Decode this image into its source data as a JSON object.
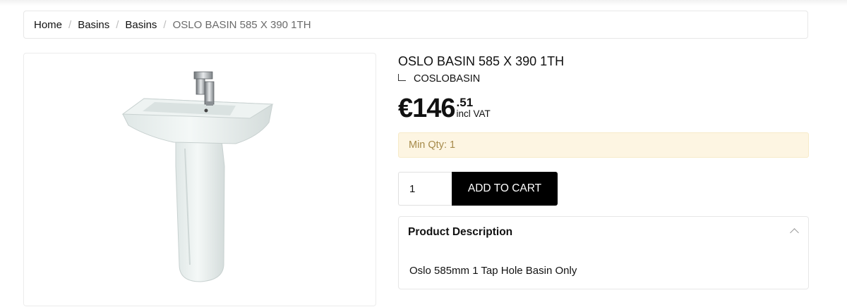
{
  "breadcrumb": {
    "items": [
      "Home",
      "Basins",
      "Basins"
    ],
    "separator": "/",
    "current": "OSLO BASIN 585 X 390 1TH"
  },
  "product": {
    "title": "OSLO BASIN 585 X 390 1TH",
    "sku": "COSLOBASIN",
    "price_main": "€146",
    "price_cents": ".51",
    "price_vat": "incl VAT",
    "min_qty": "Min Qty: 1",
    "quantity": "1",
    "add_to_cart": "ADD TO CART",
    "description_title": "Product Description",
    "description_text": "Oslo 585mm 1 Tap Hole Basin Only",
    "image_icon": "pedestal-basin-image"
  },
  "colors": {
    "button_bg": "#000000",
    "notice_bg": "#fdf5e2",
    "notice_text": "#a68a4a"
  }
}
